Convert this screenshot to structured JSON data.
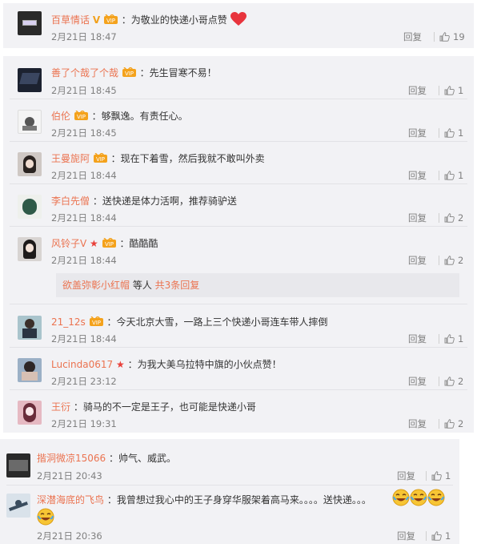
{
  "group1": [
    {
      "user": "百草情话",
      "text": "：为敬业的快递小哥点赞",
      "time": "2月21日 18:47",
      "reply": "回复",
      "likes": "19"
    }
  ],
  "group2": [
    {
      "user": "善了个哉了个哉",
      "text": "：先生冒寒不易！",
      "time": "2月21日 18:45",
      "reply": "回复",
      "likes": "1"
    },
    {
      "user": "伯伦",
      "text": "：够飘逸。有责任心。",
      "time": "2月21日 18:45",
      "reply": "回复",
      "likes": "1"
    },
    {
      "user": "王曼旎阿",
      "text": "：现在下着雪，然后我就不敢叫外卖",
      "time": "2月21日 18:44",
      "reply": "回复",
      "likes": "1"
    },
    {
      "user": "李白先僧",
      "text": "：送快递是体力活啊，推荐骑驴送",
      "time": "2月21日 18:44",
      "reply": "回复",
      "likes": "2"
    },
    {
      "user": "风铃子V",
      "text": "：酷酷酷",
      "time": "2月21日 18:44",
      "reply": "回复",
      "likes": "2"
    },
    {
      "user": "21_12s",
      "text": "：今天北京大雪，一路上三个快递小哥连车带人摔倒",
      "time": "2月21日 18:44",
      "reply": "回复",
      "likes": "1"
    },
    {
      "user": "Lucinda0617",
      "text": "：为我大美乌拉特中旗的小伙点赞！",
      "time": "2月21日 23:12",
      "reply": "回复",
      "likes": "2"
    },
    {
      "user": "王衍",
      "text": "：骑马的不一定是王子，也可能是快递小哥",
      "time": "2月21日 19:31",
      "reply": "回复",
      "likes": "2"
    }
  ],
  "more_replies": {
    "user": "欲盖弥彰小红帽",
    "mid": " 等人 ",
    "link": "共3条回复"
  },
  "group3": [
    {
      "user": "揩洞微凉15066",
      "text": "：帅气、威武。",
      "time": "2月21日 20:43",
      "reply": "回复",
      "likes": "1"
    },
    {
      "user": "深潜海底的飞鸟",
      "text": "：我曾想过我心中的王子身穿华服架着高马来。。。。送快递。。。",
      "time": "2月21日 20:36",
      "reply": "回复",
      "likes": "1"
    }
  ],
  "colors": {
    "username": "#eb7350",
    "panel_bg": "#f2f2f5",
    "meta": "#808080",
    "heart": "#e8343d",
    "vip": "#f4a21c"
  }
}
